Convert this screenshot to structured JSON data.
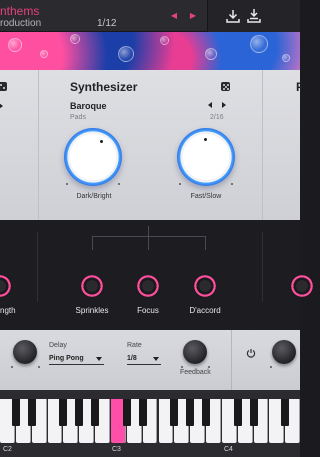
{
  "header": {
    "preset_name": "nthems",
    "preset_sub": "roduction",
    "preset_count": "1/12"
  },
  "synth": {
    "title": "Synthesizer",
    "sub_name": "Baroque",
    "sub_type": "Pads",
    "sub_count": "2/16",
    "knob1_label": "Dark/Bright",
    "knob2_label": "Fast/Slow"
  },
  "macros": {
    "left_partial_label": "ngth",
    "items": [
      {
        "label": "Sprinkles"
      },
      {
        "label": "Focus"
      },
      {
        "label": "D'accord"
      }
    ]
  },
  "fx": {
    "delay_label": "Delay",
    "delay_value": "Ping Pong",
    "rate_label": "Rate",
    "rate_value": "1/8",
    "feedback_label": "Feedback"
  },
  "keyboard": {
    "octaves": [
      "C2",
      "C3",
      "C4"
    ],
    "active_key": "C3"
  },
  "colors": {
    "accent": "#e2447a",
    "knob_blue": "#2d6fe0",
    "pink_knob": "#ff4f9c"
  }
}
